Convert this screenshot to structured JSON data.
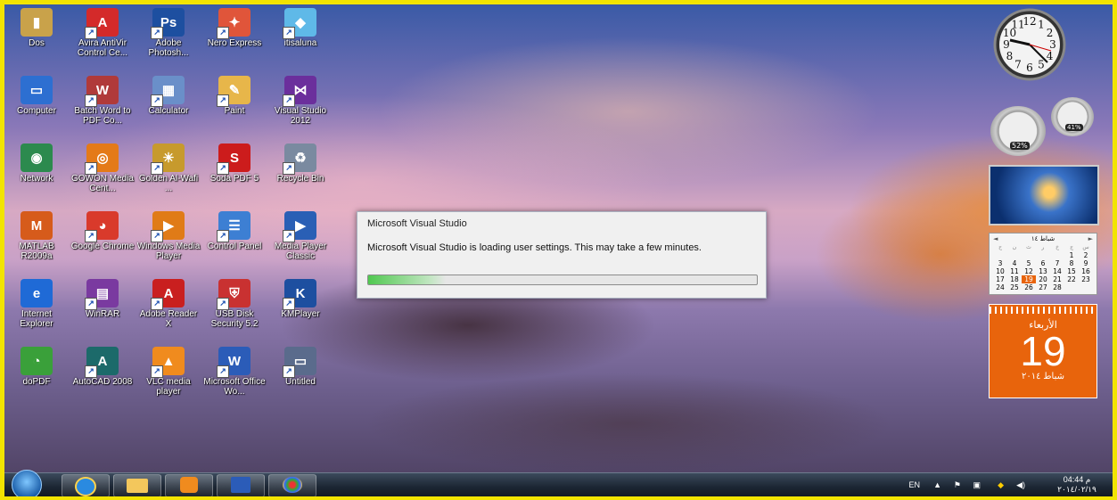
{
  "desktop_icons": [
    {
      "label": "Dos"
    },
    {
      "label": "Avira AntiVir Control Ce..."
    },
    {
      "label": "Adobe Photosh..."
    },
    {
      "label": "Nero Express"
    },
    {
      "label": "itisaluna"
    },
    {
      "label": "Computer"
    },
    {
      "label": "Batch Word to PDF Co..."
    },
    {
      "label": "Calculator"
    },
    {
      "label": "Paint"
    },
    {
      "label": "Visual Studio 2012"
    },
    {
      "label": "Network"
    },
    {
      "label": "GOWON Media Cent..."
    },
    {
      "label": "Golden Al-Wafi ..."
    },
    {
      "label": "Soda PDF 5"
    },
    {
      "label": "Recycle Bin"
    },
    {
      "label": "MATLAB R2009a"
    },
    {
      "label": "Google Chrome"
    },
    {
      "label": "Windows Media Player"
    },
    {
      "label": "Control Panel"
    },
    {
      "label": "Media Player Classic"
    },
    {
      "label": "Internet Explorer"
    },
    {
      "label": "WinRAR"
    },
    {
      "label": "Adobe Reader X"
    },
    {
      "label": "USB Disk Security 5.2"
    },
    {
      "label": "KMPlayer"
    },
    {
      "label": "doPDF"
    },
    {
      "label": "AutoCAD 2008"
    },
    {
      "label": "VLC media player"
    },
    {
      "label": "Microsoft Office Wo..."
    },
    {
      "label": "Untitled"
    }
  ],
  "dialog": {
    "title": "Microsoft Visual Studio",
    "message": "Microsoft Visual Studio is loading user settings. This may take a few minutes.",
    "progress_percent": 20
  },
  "gadgets": {
    "clock_numbers": [
      "12",
      "1",
      "2",
      "3",
      "4",
      "5",
      "6",
      "7",
      "8",
      "9",
      "10",
      "11"
    ],
    "cpu_percent": "52%",
    "memory_percent": "41%",
    "calendar_month": "شباط ١٤",
    "calendar_weekdays": [
      "ح",
      "ن",
      "ث",
      "ر",
      "خ",
      "ج",
      "س"
    ],
    "calendar_days": [
      "",
      "",
      "",
      "",
      "",
      "1",
      "2",
      "3",
      "4",
      "5",
      "6",
      "7",
      "8",
      "9",
      "10",
      "11",
      "12",
      "13",
      "14",
      "15",
      "16",
      "17",
      "18",
      "19",
      "20",
      "21",
      "22",
      "23",
      "24",
      "25",
      "26",
      "27",
      "28"
    ],
    "calendar_today": "19",
    "day_name": "الأربعاء",
    "day_number": "19",
    "month_year": "شباط ٢٠١٤"
  },
  "taskbar": {
    "language": "EN",
    "time": "04:44 م",
    "date": "٢٠١٤/٠٢/١٩"
  },
  "colors": {
    "highlight": "#f2e400",
    "calendar_orange": "#e8640c"
  }
}
